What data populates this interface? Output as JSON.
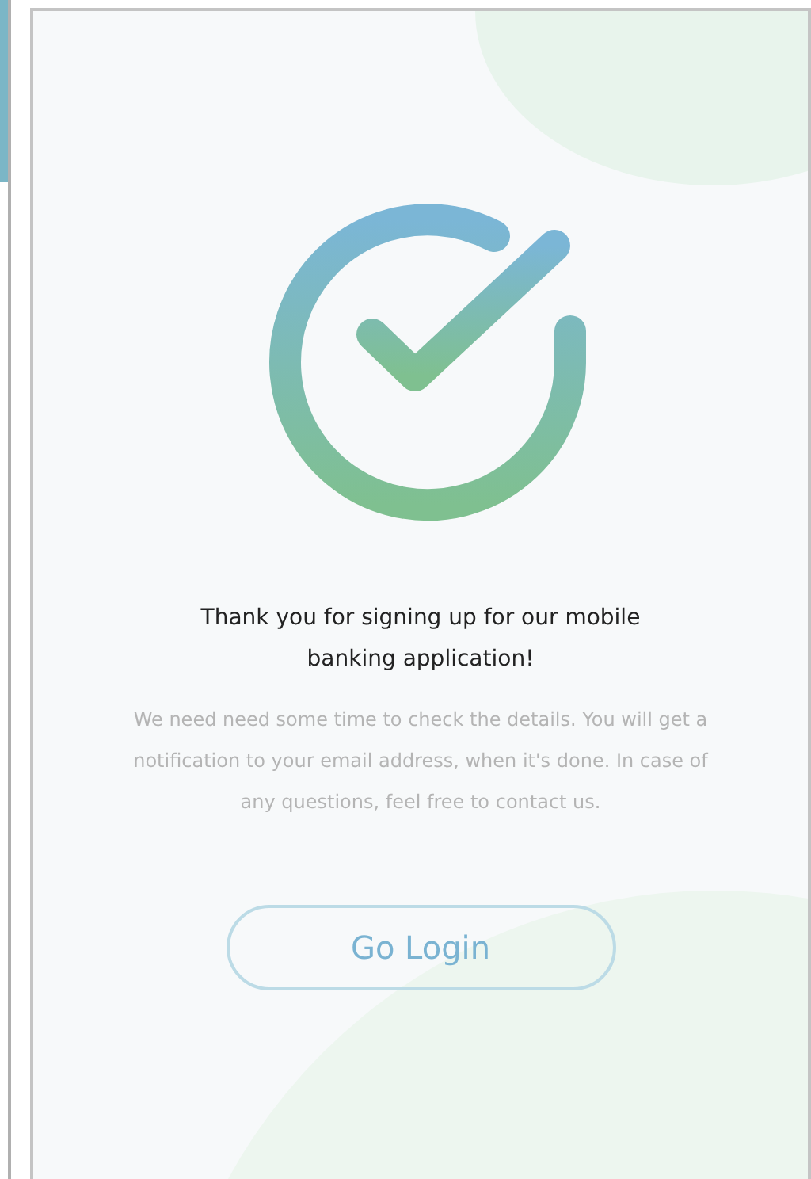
{
  "title": "Thank you for signing up for our mobile banking application!",
  "message": "We need need some time to check the details. You will get a notification to your email address, when it's done. In case of any questions, feel free to contact us.",
  "button": {
    "label": "Go Login"
  }
}
